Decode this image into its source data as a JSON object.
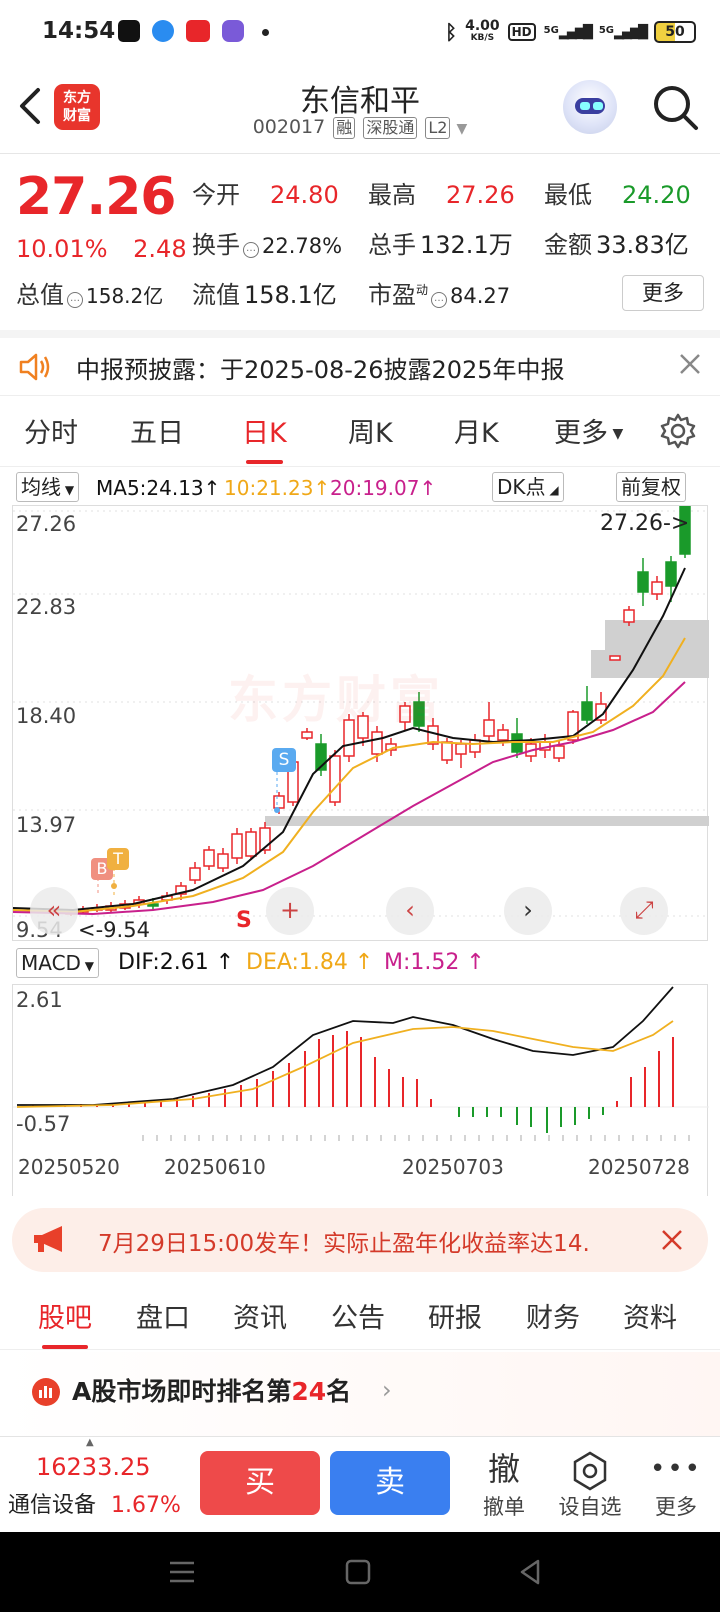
{
  "status_bar": {
    "time": "14:54",
    "network_speed_value": "4.00",
    "network_speed_unit": "KB/S",
    "hd_label": "HD",
    "signal1": "5G",
    "signal2": "5G",
    "battery": "50"
  },
  "header": {
    "logo_line1": "东方",
    "logo_line2": "财富",
    "stock_name": "东信和平",
    "stock_code": "002017",
    "tag_margin": "融",
    "tag_connect": "深股通",
    "tag_level": "L2"
  },
  "quote": {
    "price": "27.26",
    "change_pct": "10.01%",
    "change": "2.48",
    "open_label": "今开",
    "open": "24.80",
    "high_label": "最高",
    "high": "27.26",
    "low_label": "最低",
    "low": "24.20",
    "turnover_label": "换手",
    "turnover": "22.78%",
    "volume_label": "总手",
    "volume": "132.1万",
    "amount_label": "金额",
    "amount": "33.83亿",
    "mktcap_label": "总值",
    "mktcap": "158.2亿",
    "float_label": "流值",
    "float_cap": "158.1亿",
    "pe_label": "市盈",
    "pe_sup": "动",
    "pe": "84.27",
    "more_label": "更多"
  },
  "notice": {
    "text": "中报预披露：于2025-08-26披露2025年中报"
  },
  "period_tabs": [
    "分时",
    "五日",
    "日K",
    "周K",
    "月K",
    "更多"
  ],
  "active_period": 2,
  "ma_bar": {
    "selector": "均线",
    "ma5": "MA5:24.13",
    "ma10": "10:21.23",
    "ma20": "20:19.07",
    "dk": "DK点",
    "adjust": "前复权"
  },
  "kline": {
    "y_labels": [
      "27.26",
      "22.83",
      "18.40",
      "13.97",
      "9.54"
    ],
    "price_pointer": "27.26->",
    "low_pointer": "<-9.54",
    "marker_b": "B",
    "marker_t": "T",
    "marker_s": "S",
    "marker_s2": "S",
    "watermark": "东方财富",
    "nav_first": "«",
    "nav_add": "+",
    "nav_prev": "‹",
    "nav_next": "›",
    "nav_expand": "⤢",
    "colors": {
      "up": "#e8262a",
      "down": "#1a9a2a",
      "ma5": "#111111",
      "ma10": "#f0b020",
      "ma20": "#c8208c"
    }
  },
  "macd_bar": {
    "selector": "MACD",
    "dif": "DIF:2.61",
    "dea": "DEA:1.84",
    "m": "M:1.52"
  },
  "macd": {
    "y_top": "2.61",
    "y_bottom": "-0.57",
    "dates": [
      "20250520",
      "20250610",
      "20250703",
      "20250728"
    ]
  },
  "banner": {
    "text": "7月29日15:00发车！实际止盈年化收益率达14."
  },
  "section_tabs": [
    "股吧",
    "盘口",
    "资讯",
    "公告",
    "研报",
    "财务",
    "资料"
  ],
  "rank": {
    "prefix": "A股市场即时排名第",
    "num": "24",
    "suffix": "名"
  },
  "bottom_bar": {
    "index_value": "16233.25",
    "industry": "通信设备",
    "industry_change": "1.67%",
    "buy": "买",
    "sell": "卖",
    "cancel_icon": "撤",
    "cancel": "撤单",
    "watchlist": "设自选",
    "more": "更多"
  }
}
